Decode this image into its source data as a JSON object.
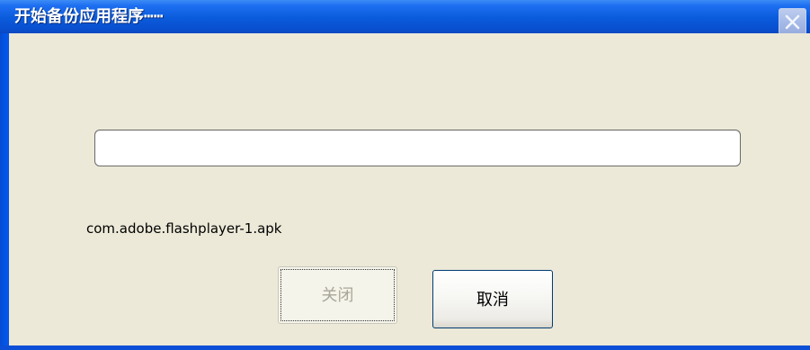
{
  "window": {
    "title": "开始备份应用程序┅┅"
  },
  "titlebar": {
    "close_icon": "close-icon"
  },
  "progress": {
    "value": 0
  },
  "status": {
    "current_file": "com.adobe.flashplayer-1.apk"
  },
  "buttons": {
    "close_label": "关闭",
    "cancel_label": "取消"
  },
  "colors": {
    "titlebar": "#0a5bdc",
    "dialog_background": "#ece9d8",
    "button_border": "#003c74"
  }
}
